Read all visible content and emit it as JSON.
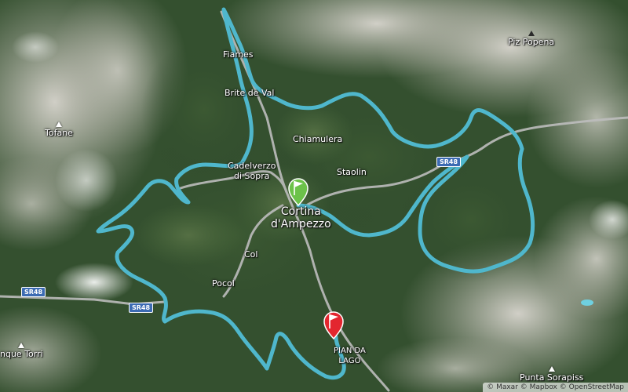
{
  "map": {
    "places": {
      "fiames": "Fiames",
      "brite_de_val": "Brite de Val",
      "chiamulera": "Chiamulera",
      "cadelverzo_line1": "Cadelverzo",
      "cadelverzo_line2": "di Sopra",
      "staolin": "Staolin",
      "cortina_line1": "Cortina",
      "cortina_line2": "d'Ampezzo",
      "col": "Col",
      "pocol": "Pocol",
      "pian_da_lago_line1": "PIAN DA",
      "pian_da_lago_line2": "LAGO"
    },
    "peaks": {
      "tofane": "Tofane",
      "piz_popena": "Piz Popena",
      "cinque_torri": "nque Torri",
      "punta_sorapiss": "Punta Sorapiss"
    },
    "roads": {
      "sr48_east": "SR48",
      "sr48_west": "SR48",
      "sr48_south": "SR48"
    },
    "markers": {
      "start": {
        "name": "start-flag",
        "color": "#6cc24a"
      },
      "finish": {
        "name": "finish-flag",
        "color": "#e3262f"
      }
    },
    "route_color": "#4fb7cc",
    "attribution": "© Maxar © Mapbox © OpenStreetMap"
  }
}
